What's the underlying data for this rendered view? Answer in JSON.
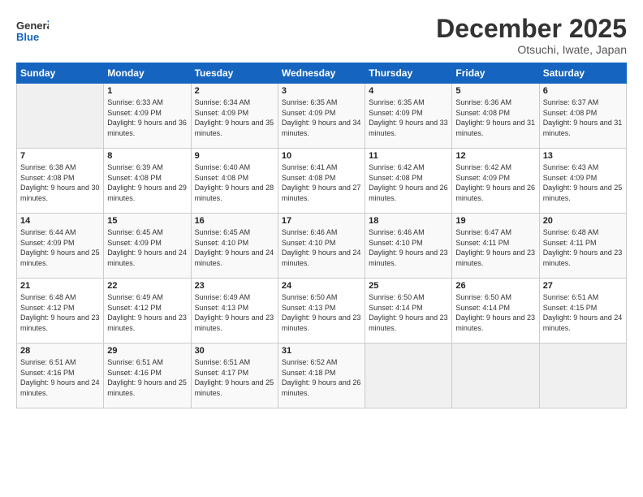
{
  "header": {
    "logo_line1": "General",
    "logo_line2": "Blue",
    "month": "December 2025",
    "location": "Otsuchi, Iwate, Japan"
  },
  "weekdays": [
    "Sunday",
    "Monday",
    "Tuesday",
    "Wednesday",
    "Thursday",
    "Friday",
    "Saturday"
  ],
  "weeks": [
    [
      {
        "day": "",
        "sunrise": "",
        "sunset": "",
        "daylight": ""
      },
      {
        "day": "1",
        "sunrise": "Sunrise: 6:33 AM",
        "sunset": "Sunset: 4:09 PM",
        "daylight": "Daylight: 9 hours and 36 minutes."
      },
      {
        "day": "2",
        "sunrise": "Sunrise: 6:34 AM",
        "sunset": "Sunset: 4:09 PM",
        "daylight": "Daylight: 9 hours and 35 minutes."
      },
      {
        "day": "3",
        "sunrise": "Sunrise: 6:35 AM",
        "sunset": "Sunset: 4:09 PM",
        "daylight": "Daylight: 9 hours and 34 minutes."
      },
      {
        "day": "4",
        "sunrise": "Sunrise: 6:35 AM",
        "sunset": "Sunset: 4:09 PM",
        "daylight": "Daylight: 9 hours and 33 minutes."
      },
      {
        "day": "5",
        "sunrise": "Sunrise: 6:36 AM",
        "sunset": "Sunset: 4:08 PM",
        "daylight": "Daylight: 9 hours and 31 minutes."
      },
      {
        "day": "6",
        "sunrise": "Sunrise: 6:37 AM",
        "sunset": "Sunset: 4:08 PM",
        "daylight": "Daylight: 9 hours and 31 minutes."
      }
    ],
    [
      {
        "day": "7",
        "sunrise": "Sunrise: 6:38 AM",
        "sunset": "Sunset: 4:08 PM",
        "daylight": "Daylight: 9 hours and 30 minutes."
      },
      {
        "day": "8",
        "sunrise": "Sunrise: 6:39 AM",
        "sunset": "Sunset: 4:08 PM",
        "daylight": "Daylight: 9 hours and 29 minutes."
      },
      {
        "day": "9",
        "sunrise": "Sunrise: 6:40 AM",
        "sunset": "Sunset: 4:08 PM",
        "daylight": "Daylight: 9 hours and 28 minutes."
      },
      {
        "day": "10",
        "sunrise": "Sunrise: 6:41 AM",
        "sunset": "Sunset: 4:08 PM",
        "daylight": "Daylight: 9 hours and 27 minutes."
      },
      {
        "day": "11",
        "sunrise": "Sunrise: 6:42 AM",
        "sunset": "Sunset: 4:08 PM",
        "daylight": "Daylight: 9 hours and 26 minutes."
      },
      {
        "day": "12",
        "sunrise": "Sunrise: 6:42 AM",
        "sunset": "Sunset: 4:09 PM",
        "daylight": "Daylight: 9 hours and 26 minutes."
      },
      {
        "day": "13",
        "sunrise": "Sunrise: 6:43 AM",
        "sunset": "Sunset: 4:09 PM",
        "daylight": "Daylight: 9 hours and 25 minutes."
      }
    ],
    [
      {
        "day": "14",
        "sunrise": "Sunrise: 6:44 AM",
        "sunset": "Sunset: 4:09 PM",
        "daylight": "Daylight: 9 hours and 25 minutes."
      },
      {
        "day": "15",
        "sunrise": "Sunrise: 6:45 AM",
        "sunset": "Sunset: 4:09 PM",
        "daylight": "Daylight: 9 hours and 24 minutes."
      },
      {
        "day": "16",
        "sunrise": "Sunrise: 6:45 AM",
        "sunset": "Sunset: 4:10 PM",
        "daylight": "Daylight: 9 hours and 24 minutes."
      },
      {
        "day": "17",
        "sunrise": "Sunrise: 6:46 AM",
        "sunset": "Sunset: 4:10 PM",
        "daylight": "Daylight: 9 hours and 24 minutes."
      },
      {
        "day": "18",
        "sunrise": "Sunrise: 6:46 AM",
        "sunset": "Sunset: 4:10 PM",
        "daylight": "Daylight: 9 hours and 23 minutes."
      },
      {
        "day": "19",
        "sunrise": "Sunrise: 6:47 AM",
        "sunset": "Sunset: 4:11 PM",
        "daylight": "Daylight: 9 hours and 23 minutes."
      },
      {
        "day": "20",
        "sunrise": "Sunrise: 6:48 AM",
        "sunset": "Sunset: 4:11 PM",
        "daylight": "Daylight: 9 hours and 23 minutes."
      }
    ],
    [
      {
        "day": "21",
        "sunrise": "Sunrise: 6:48 AM",
        "sunset": "Sunset: 4:12 PM",
        "daylight": "Daylight: 9 hours and 23 minutes."
      },
      {
        "day": "22",
        "sunrise": "Sunrise: 6:49 AM",
        "sunset": "Sunset: 4:12 PM",
        "daylight": "Daylight: 9 hours and 23 minutes."
      },
      {
        "day": "23",
        "sunrise": "Sunrise: 6:49 AM",
        "sunset": "Sunset: 4:13 PM",
        "daylight": "Daylight: 9 hours and 23 minutes."
      },
      {
        "day": "24",
        "sunrise": "Sunrise: 6:50 AM",
        "sunset": "Sunset: 4:13 PM",
        "daylight": "Daylight: 9 hours and 23 minutes."
      },
      {
        "day": "25",
        "sunrise": "Sunrise: 6:50 AM",
        "sunset": "Sunset: 4:14 PM",
        "daylight": "Daylight: 9 hours and 23 minutes."
      },
      {
        "day": "26",
        "sunrise": "Sunrise: 6:50 AM",
        "sunset": "Sunset: 4:14 PM",
        "daylight": "Daylight: 9 hours and 23 minutes."
      },
      {
        "day": "27",
        "sunrise": "Sunrise: 6:51 AM",
        "sunset": "Sunset: 4:15 PM",
        "daylight": "Daylight: 9 hours and 24 minutes."
      }
    ],
    [
      {
        "day": "28",
        "sunrise": "Sunrise: 6:51 AM",
        "sunset": "Sunset: 4:16 PM",
        "daylight": "Daylight: 9 hours and 24 minutes."
      },
      {
        "day": "29",
        "sunrise": "Sunrise: 6:51 AM",
        "sunset": "Sunset: 4:16 PM",
        "daylight": "Daylight: 9 hours and 25 minutes."
      },
      {
        "day": "30",
        "sunrise": "Sunrise: 6:51 AM",
        "sunset": "Sunset: 4:17 PM",
        "daylight": "Daylight: 9 hours and 25 minutes."
      },
      {
        "day": "31",
        "sunrise": "Sunrise: 6:52 AM",
        "sunset": "Sunset: 4:18 PM",
        "daylight": "Daylight: 9 hours and 26 minutes."
      },
      {
        "day": "",
        "sunrise": "",
        "sunset": "",
        "daylight": ""
      },
      {
        "day": "",
        "sunrise": "",
        "sunset": "",
        "daylight": ""
      },
      {
        "day": "",
        "sunrise": "",
        "sunset": "",
        "daylight": ""
      }
    ]
  ]
}
